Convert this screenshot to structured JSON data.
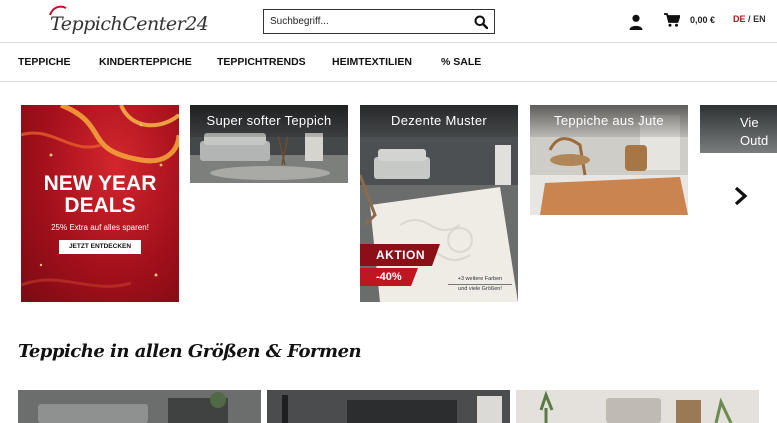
{
  "header": {
    "logo_text": "TeppichCenter24",
    "search_placeholder": "Suchbegriff...",
    "cart_total": "0,00 €",
    "lang_active": "DE",
    "lang_sep": "/",
    "lang_other": "EN"
  },
  "nav": {
    "items": [
      {
        "label": "TEPPICHE"
      },
      {
        "label": "KINDERTEPPICHE"
      },
      {
        "label": "TEPPICHTRENDS"
      },
      {
        "label": "HEIMTEXTILIEN"
      },
      {
        "label": "% SALE"
      }
    ]
  },
  "carousel": {
    "promo": {
      "heading_line1": "NEW YEAR",
      "heading_line2": "DEALS",
      "subtitle": "25% Extra auf alles sparen!",
      "button": "JETZT ENTDECKEN"
    },
    "tiles": [
      {
        "title": "Super softer Teppich"
      },
      {
        "title": "Dezente Muster",
        "badge": "AKTION",
        "discount": "-40%",
        "note_line1": "+3 weitere Farben",
        "note_line2": "und viele Größen!"
      },
      {
        "title": "Teppiche aus Jute"
      },
      {
        "title_line1": "Vie",
        "title_line2": "Outd"
      }
    ]
  },
  "section": {
    "title": "Teppiche in allen Größen & Formen"
  },
  "colors": {
    "brand_red": "#b8111f",
    "promo_red": "#a3101b"
  }
}
